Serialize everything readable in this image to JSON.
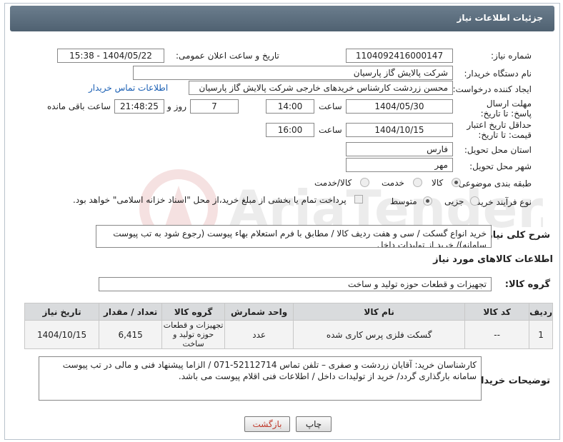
{
  "header": {
    "title": "جزئیات اطلاعات نیاز"
  },
  "fields": {
    "need_number_label": "شماره نیاز:",
    "need_number": "1104092416000147",
    "announce_label": "تاریخ و ساعت اعلان عمومی:",
    "announce_value": "1404/05/22 - 15:38",
    "buyer_org_label": "نام دستگاه خریدار:",
    "buyer_org": "شرکت پالایش گاز پارسیان",
    "requester_label": "ایجاد کننده درخواست:",
    "requester": "محسن زردشت کارشناس خریدهای خارجی شرکت پالایش گاز پارسیان",
    "contact_link": "اطلاعات تماس خریدار",
    "reply_deadline_label": "مهلت ارسال پاسخ: تا تاریخ:",
    "reply_date": "1404/05/30",
    "time_label": "ساعت",
    "reply_time": "14:00",
    "days_value": "7",
    "days_label": "روز و",
    "remaining_time": "21:48:25",
    "remaining_label": "ساعت باقی مانده",
    "price_validity_label": "حداقل تاریخ اعتبار قیمت: تا تاریخ:",
    "validity_date": "1404/10/15",
    "validity_time": "16:00",
    "province_label": "استان محل تحویل:",
    "province": "فارس",
    "city_label": "شهر محل تحویل:",
    "city": "مهر",
    "category_label": "طبقه بندی موضوعی:",
    "category_options": [
      "کالا",
      "خدمت",
      "کالا/خدمت"
    ],
    "process_label": "نوع فرآیند خرید :",
    "process_options": [
      "جزیی",
      "متوسط"
    ],
    "payment_note": "پرداخت تمام یا بخشی از مبلغ خرید،از محل \"اسناد خزانه اسلامی\" خواهد بود.",
    "summary_label": "شرح کلی نیاز:",
    "summary": "خرید انواع گسکت / سی و هفت ردیف کالا / مطابق با فرم استعلام بهاء پیوست (رجوع شود به تب پیوست سامانه)/ خرید از تولیدات داخل",
    "goods_info_label": "اطلاعات کالاهای مورد نیاز",
    "goods_group_label": "گروه کالا:",
    "goods_group": "تجهیزات و قطعات حوزه تولید و ساخت",
    "buyer_notes_label": "توضیحات خریدار:",
    "buyer_notes": "کارشناسان خرید: آقایان زردشت و صفری – تلفن تماس 52112714-071 / الزاما پیشنهاد فنی و مالی در تب پیوست سامانه بارگذاری گردد/ خرید از تولیدات داخل / اطلاعات فنی اقلام پیوست می باشد."
  },
  "table": {
    "headers": [
      "ردیف",
      "کد کالا",
      "نام کالا",
      "واحد شمارش",
      "گروه کالا",
      "تعداد / مقدار",
      "تاریخ نیاز"
    ],
    "rows": [
      [
        "1",
        "--",
        "گسکت فلزی پرس کاری شده",
        "عدد",
        "تجهیزات و قطعات حوزه تولید و ساخت",
        "6,415",
        "1404/10/15"
      ]
    ]
  },
  "buttons": {
    "print": "چاپ",
    "back": "بازگشت"
  },
  "watermark_text": "AriaTender.neT",
  "colors": {
    "header": "#55687a",
    "link": "#1a5fb4",
    "back_text": "#c0392b"
  }
}
